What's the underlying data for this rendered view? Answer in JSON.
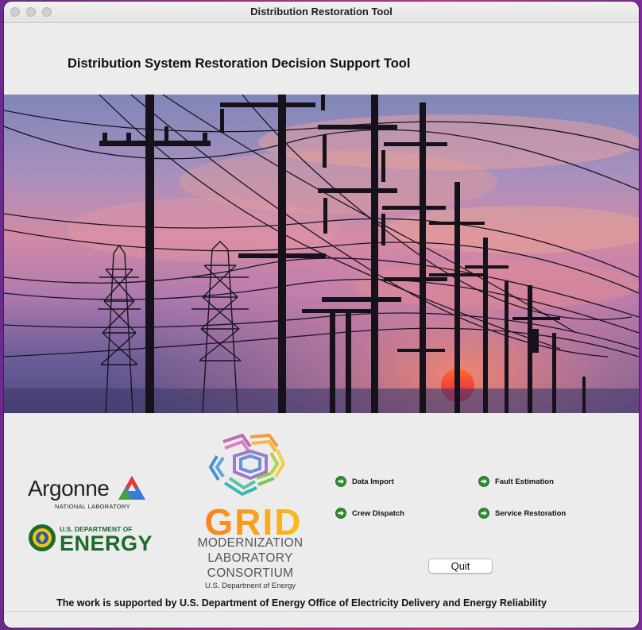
{
  "window": {
    "title": "Distribution Restoration Tool"
  },
  "header": {
    "heading": "Distribution System Restoration Decision Support Tool"
  },
  "hero": {
    "description_icon": "power-lines-sunset-image"
  },
  "logos": {
    "argonne": {
      "name": "Argonne",
      "sub": "NATIONAL LABORATORY"
    },
    "doe": {
      "top": "U.S. DEPARTMENT OF",
      "main": "ENERGY"
    },
    "grid": {
      "word": "GRID",
      "line1": "MODERNIZATION",
      "line2": "LABORATORY",
      "line3": "CONSORTIUM",
      "small": "U.S. Department of Energy"
    }
  },
  "actions": {
    "data_import": "Data Import",
    "fault_estimation": "Fault Estimation",
    "crew_dispatch": "Crew Dispatch",
    "service_restoration": "Service Restoration",
    "icon": "green-arrow-icon"
  },
  "buttons": {
    "quit": "Quit"
  },
  "footer": {
    "text": "The work is supported by U.S. Department of Energy Office of Electricity Delivery and Energy Reliability"
  },
  "colors": {
    "doe_green": "#1b6b2a",
    "arrow_green": "#2e8b2e",
    "grid_orange": "#f47c20"
  }
}
